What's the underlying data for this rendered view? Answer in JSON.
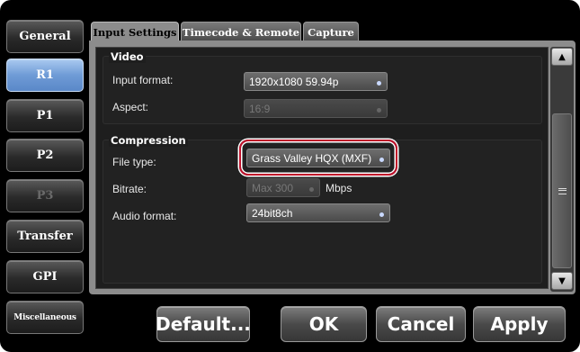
{
  "nav": {
    "items": [
      {
        "label": "General"
      },
      {
        "label": "R1"
      },
      {
        "label": "P1"
      },
      {
        "label": "P2"
      },
      {
        "label": "P3"
      },
      {
        "label": "Transfer"
      },
      {
        "label": "GPI"
      },
      {
        "label": "Miscellaneous"
      }
    ]
  },
  "tabs": [
    {
      "label": "Input Settings"
    },
    {
      "label": "Timecode & Remote"
    },
    {
      "label": "Capture"
    }
  ],
  "video": {
    "title": "Video",
    "input_format_label": "Input format:",
    "input_format_value": "1920x1080 59.94p",
    "aspect_label": "Aspect:",
    "aspect_value": "16:9"
  },
  "compression": {
    "title": "Compression",
    "file_type_label": "File type:",
    "file_type_value": "Grass Valley HQX (MXF)",
    "bitrate_label": "Bitrate:",
    "bitrate_value": "Max 300",
    "bitrate_unit": "Mbps",
    "audio_format_label": "Audio format:",
    "audio_format_value": "24bit8ch"
  },
  "buttons": {
    "default": "Default...",
    "ok": "OK",
    "cancel": "Cancel",
    "apply": "Apply"
  },
  "colors": {
    "active_nav": "#6f9bd6",
    "highlight": "#c0102a"
  }
}
